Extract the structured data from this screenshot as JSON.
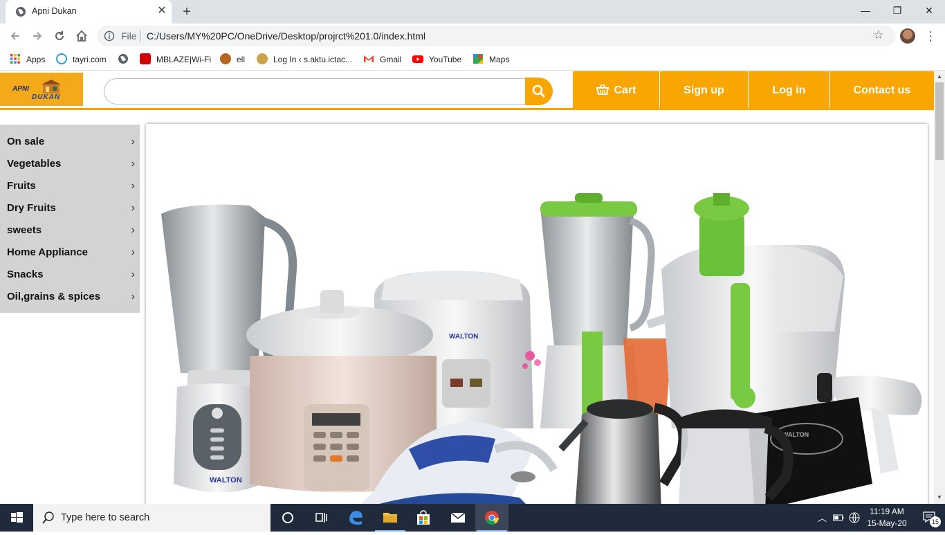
{
  "browser": {
    "tab_title": "Apni Dukan",
    "tab_close": "✕",
    "new_tab": "+",
    "window_controls": {
      "minimize": "—",
      "restore": "❐",
      "close": "✕"
    },
    "omnibox_scheme": "File",
    "url": "C:/Users/MY%20PC/OneDrive/Desktop/projrct%201.0/index.html",
    "bookmarks": [
      {
        "label": "Apps",
        "icon": "apps-grid-icon"
      },
      {
        "label": "tayri.com",
        "icon": "tayri-icon"
      },
      {
        "label": "",
        "icon": "globe-icon"
      },
      {
        "label": "MBLAZE|Wi-Fi",
        "icon": "mblaze-icon"
      },
      {
        "label": "ell",
        "icon": "ell-icon"
      },
      {
        "label": "Log In ‹ s.aktu.ictac...",
        "icon": "aktu-icon"
      },
      {
        "label": "Gmail",
        "icon": "gmail-icon"
      },
      {
        "label": "YouTube",
        "icon": "youtube-icon"
      },
      {
        "label": "Maps",
        "icon": "maps-icon"
      }
    ]
  },
  "site": {
    "logo_text_top": "APNI",
    "logo_text_bottom": "DUKAN",
    "search_placeholder": "",
    "nav": [
      {
        "label": "Cart",
        "icon": "basket-icon"
      },
      {
        "label": "Sign up"
      },
      {
        "label": "Log in"
      },
      {
        "label": "Contact us"
      }
    ],
    "categories": [
      "On sale",
      "Vegetables",
      "Fruits",
      "Dry Fruits",
      "sweets",
      "Home Appliance",
      "Snacks",
      "Oil,grains & spices"
    ],
    "brand_label": "WALTON",
    "colors": {
      "accent": "#f9a602",
      "sidebar": "#d3d3d3",
      "apple_green": "#7ac943"
    }
  },
  "taskbar": {
    "search_placeholder": "Type here to search",
    "time": "11:19 AM",
    "date": "15-May-20",
    "notification_count": "15"
  }
}
